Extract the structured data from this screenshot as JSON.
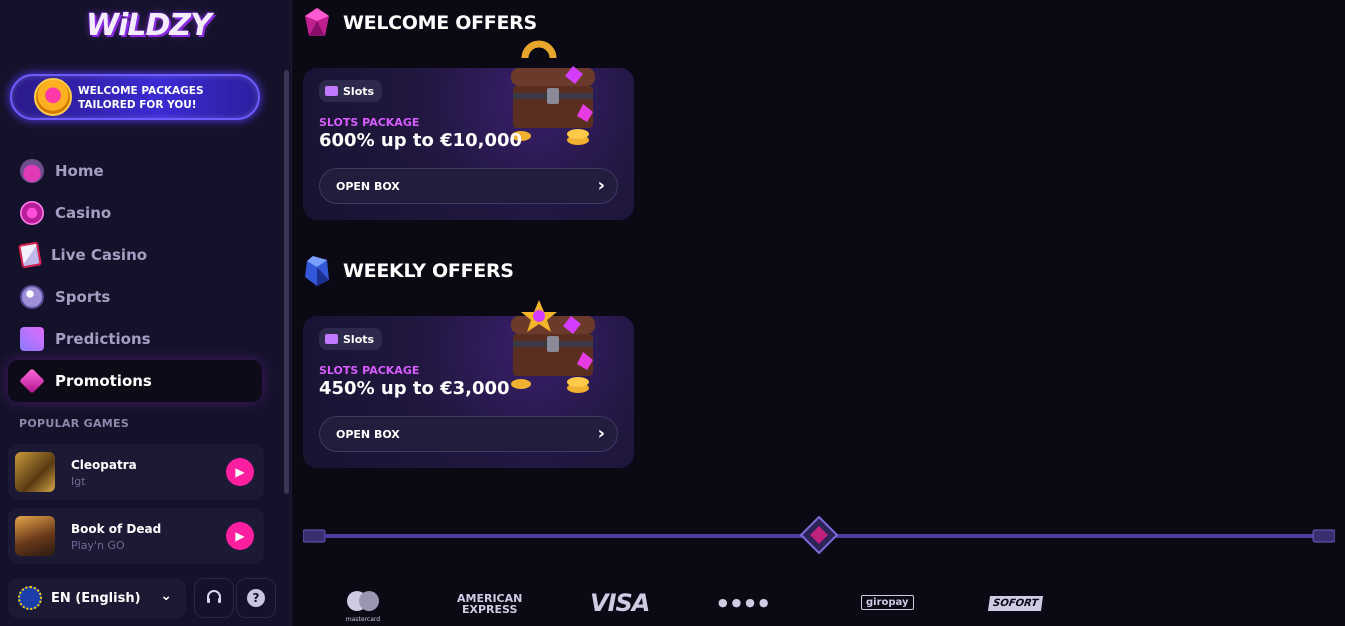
{
  "brand": {
    "logo_text": "WiLDZY"
  },
  "promo_banner": {
    "text": "WELCOME PACKAGES TAILORED FOR YOU!"
  },
  "nav": {
    "items": [
      {
        "label": "Home",
        "icon": "home-icon"
      },
      {
        "label": "Casino",
        "icon": "casino-chip-icon"
      },
      {
        "label": "Live Casino",
        "icon": "playing-cards-icon"
      },
      {
        "label": "Sports",
        "icon": "soccer-ball-icon"
      },
      {
        "label": "Predictions",
        "icon": "chart-icon"
      },
      {
        "label": "Promotions",
        "icon": "diamond-icon",
        "active": true
      }
    ]
  },
  "popular_games": {
    "label": "POPULAR GAMES",
    "items": [
      {
        "name": "Cleopatra",
        "provider": "Igt"
      },
      {
        "name": "Book of Dead",
        "provider": "Play'n GO"
      }
    ]
  },
  "footer_controls": {
    "language": "EN (English)",
    "support_icon": "headset-icon",
    "help_icon": "help-icon"
  },
  "welcome": {
    "title": "WELCOME OFFERS",
    "card": {
      "tag": "Slots",
      "package_label": "SLOTS PACKAGE",
      "amount": "600% up to €10,000",
      "button": "OPEN BOX"
    }
  },
  "weekly": {
    "title": "WEEKLY OFFERS",
    "card": {
      "tag": "Slots",
      "package_label": "SLOTS PACKAGE",
      "amount": "450% up to €3,000",
      "button": "OPEN BOX"
    }
  },
  "payments": {
    "mastercard": "mastercard",
    "amex_line1": "AMERICAN",
    "amex_line2": "EXPRESS",
    "visa": "VISA",
    "giropay": "giropay",
    "sofort": "SOFORT"
  },
  "colors": {
    "accent_pink": "#ff1ea0",
    "package_purple": "#d85dff",
    "sidebar_bg": "#14122a",
    "page_bg": "#0a0914"
  }
}
